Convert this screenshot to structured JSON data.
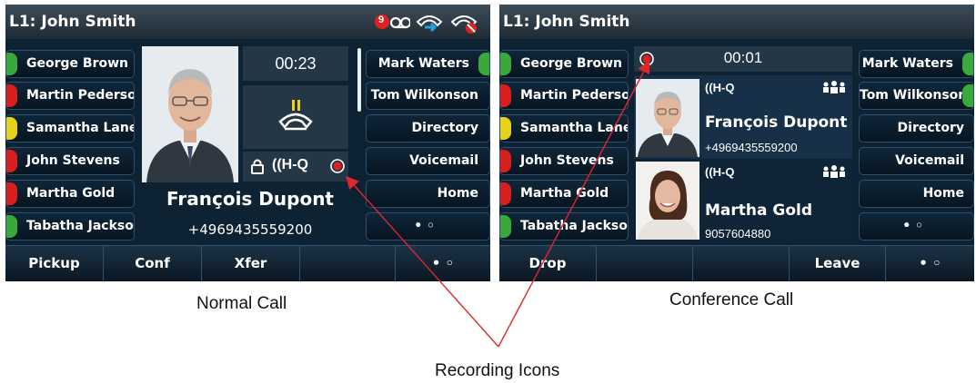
{
  "normal": {
    "title": "L1: John Smith",
    "left_keys": [
      {
        "label": "George Brown",
        "led": "#3aa83a"
      },
      {
        "label": "Martin Pederson",
        "led": "#d81f1f"
      },
      {
        "label": "Samantha Lane",
        "led": "#e6d21a"
      },
      {
        "label": "John Stevens",
        "led": "#d81f1f"
      },
      {
        "label": "Martha Gold",
        "led": "#d81f1f"
      },
      {
        "label": "Tabatha Jackson",
        "led": "#3aa83a"
      }
    ],
    "right_keys": [
      {
        "label": "Mark Waters",
        "led": "#3aa83a"
      },
      {
        "label": "Tom Wilkonson",
        "led": ""
      },
      {
        "label": "Directory",
        "led": ""
      },
      {
        "label": "Voicemail",
        "led": ""
      },
      {
        "label": "Home",
        "led": ""
      },
      {
        "label": "• ◦",
        "led": ""
      }
    ],
    "timer": "00:23",
    "hiq": "((H-Q",
    "caller_name": "François Dupont",
    "caller_number": "+4969435559200",
    "voicemail_count": "9",
    "softkeys": [
      "Pickup",
      "Conf",
      "Xfer",
      "",
      "• ◦"
    ]
  },
  "conf": {
    "title": "L1: John Smith",
    "left_keys": [
      {
        "label": "George Brown",
        "led": "#3aa83a"
      },
      {
        "label": "Martin Pederson",
        "led": "#d81f1f"
      },
      {
        "label": "Samantha Lane",
        "led": "#e6d21a"
      },
      {
        "label": "John Stevens",
        "led": "#d81f1f"
      },
      {
        "label": "Martha Gold",
        "led": "#d81f1f"
      },
      {
        "label": "Tabatha Jackson",
        "led": "#3aa83a"
      }
    ],
    "right_keys": [
      {
        "label": "Mark Waters",
        "led": "#3aa83a"
      },
      {
        "label": "Tom Wilkonson",
        "led": "#3aa83a"
      },
      {
        "label": "Directory",
        "led": ""
      },
      {
        "label": "Voicemail",
        "led": ""
      },
      {
        "label": "Home",
        "led": ""
      },
      {
        "label": "• ◦",
        "led": ""
      }
    ],
    "timer": "00:01",
    "participants": [
      {
        "hiq": "((H-Q",
        "name": "François Dupont",
        "number": "+4969435559200"
      },
      {
        "hiq": "((H-Q",
        "name": "Martha Gold",
        "number": "9057604880"
      }
    ],
    "softkeys": [
      "Drop",
      "",
      "",
      "Leave",
      "• ◦"
    ]
  },
  "captions": {
    "normal": "Normal Call",
    "conference": "Conference Call",
    "recording": "Recording Icons"
  },
  "colors": {
    "recording": "#e02020",
    "arrow": "#e0262f",
    "screen_bg": "#0d2233"
  }
}
